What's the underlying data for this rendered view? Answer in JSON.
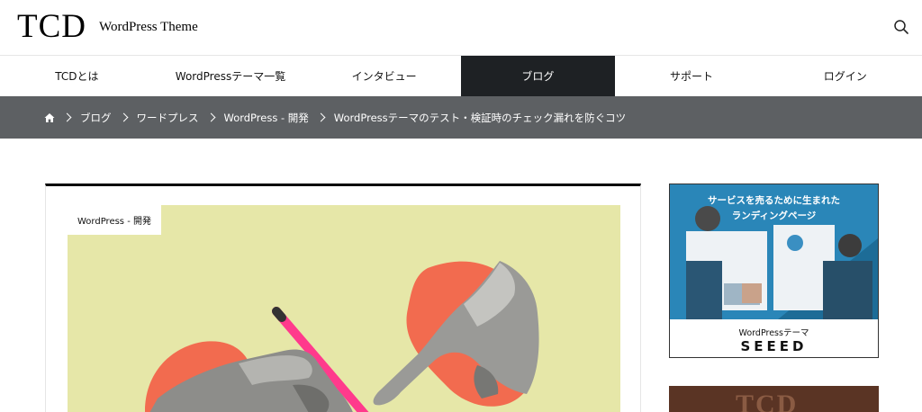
{
  "header": {
    "logo": "TCD",
    "tagline": "WordPress Theme",
    "search_icon": "search-icon"
  },
  "nav": {
    "items": [
      {
        "label": "TCDとは"
      },
      {
        "label": "WordPressテーマ一覧"
      },
      {
        "label": "インタビュー"
      },
      {
        "label": "ブログ",
        "active": true
      },
      {
        "label": "サポート"
      },
      {
        "label": "ログイン"
      }
    ],
    "active_color": "#1e2124"
  },
  "breadcrumb": {
    "home_icon": "home-icon",
    "items": [
      "ブログ",
      "ワードプレス",
      "WordPress - 開発",
      "WordPressテーマのテスト・検証時のチェック漏れを防ぐコツ"
    ],
    "background": "#5d6063"
  },
  "article": {
    "category": "WordPress - 開発",
    "hero_background": "#e6e7a8",
    "accent": "#f26b4f"
  },
  "sidebar": {
    "banner": {
      "headline_line1": "サービスを売るために生まれた",
      "headline_line2": "ランディングページ",
      "subtitle": "WordPressテーマ",
      "product": "SEEED"
    },
    "banner2": {
      "text": "TCD"
    }
  }
}
